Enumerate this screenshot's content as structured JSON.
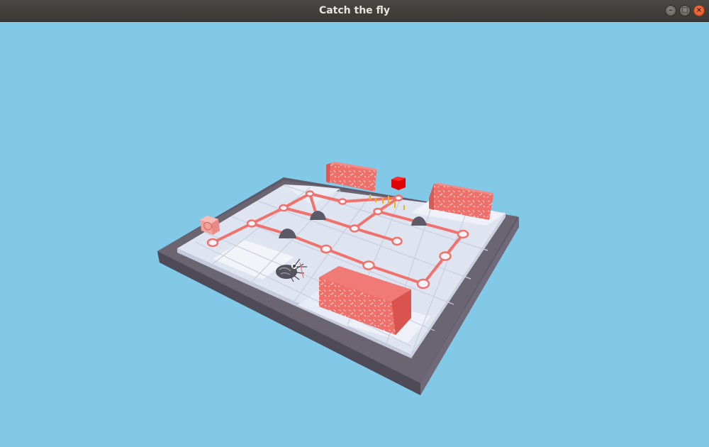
{
  "window": {
    "title": "Catch the fly",
    "controls": {
      "minimize_icon": "minimize-icon",
      "maximize_icon": "maximize-icon",
      "close_icon": "close-icon"
    }
  },
  "scene": {
    "background_color": "#82c9e8",
    "board_color": "#dfe4f1",
    "frame_color": "#6b6572",
    "wall_color": "#ef6f6a",
    "path_color": "#f0726d",
    "rock_color": "#5c5a66",
    "goal_color": "#ff0000",
    "objects": [
      "spider",
      "fly",
      "goal-cube",
      "target-cube",
      "rocks",
      "walls"
    ]
  }
}
